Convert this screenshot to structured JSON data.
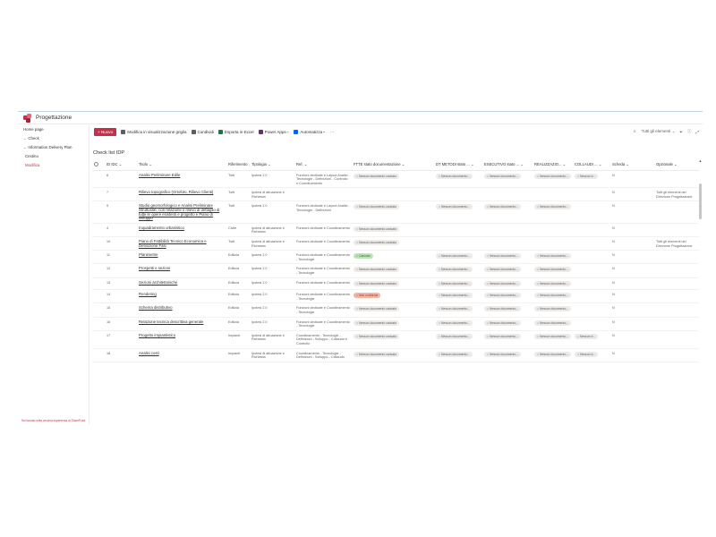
{
  "app": {
    "title": "Progettazione"
  },
  "sidebar": {
    "items": [
      {
        "label": "Home page",
        "level": 1
      },
      {
        "label": "Check",
        "level": 1,
        "expandable": true
      },
      {
        "label": "Information Delivery Plan",
        "level": 1,
        "expandable": true
      },
      {
        "label": "Cestino",
        "level": 2
      },
      {
        "label": "Modifica",
        "level": 2,
        "active": true
      }
    ],
    "footer": "Sei tornato nella vecchia esperienza di SharePoint"
  },
  "toolbar": {
    "new_label": "Nuovo",
    "commands": [
      {
        "label": "Modifica in visualizzazione griglia",
        "icon": "grid-icon",
        "color": "#605e5c"
      },
      {
        "label": "Condividi",
        "icon": "share-icon",
        "color": "#605e5c"
      },
      {
        "label": "Esporta in Excel",
        "icon": "excel-icon",
        "color": "#217346"
      },
      {
        "label": "Power Apps",
        "icon": "powerapps-icon",
        "color": "#742774"
      },
      {
        "label": "Automatizza",
        "icon": "flow-icon",
        "color": "#0066ff"
      }
    ],
    "more": "···",
    "view_label": "Tutti gli elementi"
  },
  "list": {
    "title": "Check list IDP",
    "columns": [
      "ID IDC",
      "Titolo",
      "Riferimento",
      "Tipologia",
      "Ref.",
      "FTTE stato documentazione",
      "DT METODI stato ...",
      "ESECUTIVO stato ...",
      "REALIZZAZIO...",
      "COLLAUDI ...",
      "Scheda",
      "Opzionale"
    ],
    "rows": [
      {
        "id": "8",
        "title": "Analisi Preliminare Edile",
        "rif": "Tutti",
        "tip": "Ipotesi 2.0",
        "ref": "Funzioni dedicate e Layout Analisi - Tecnologie - Definizioni - Controllo e Coordinamento",
        "ftte": "Nessun documento caricato",
        "dt": "Nessun documento...",
        "ese": "Nessun documento...",
        "real": "Nessun documento...",
        "coll": "Nessun d...",
        "scheda": "N",
        "opz": ""
      },
      {
        "id": "7",
        "title": "Rilievo topografico (Ortofoto, Rilievo Clienti)",
        "rif": "Tutti",
        "tip": "Ipotesi di attuazione e Richiesta",
        "ref": "",
        "ftte": "",
        "dt": "",
        "ese": "",
        "real": "",
        "coll": "",
        "scheda": "N",
        "opz": "Tutti gli elementi del Direzione Progettazione"
      },
      {
        "id": "9",
        "title": "Studio geomorfologico e Analisi Preliminare Strutturale, con relazione e rilievo di dettaglio di tutte le opere esistenti e progetto e Piano di sviluppo",
        "rif": "Tutti",
        "tip": "Ipotesi 2.0",
        "ref": "Funzioni dedicate e Layout Analisi - Tecnologie - Definizioni",
        "ftte": "Nessun documento caricato",
        "dt": "Nessun documento...",
        "ese": "Nessun documento...",
        "real": "Nessun documento...",
        "coll": "",
        "scheda": "N",
        "opz": ""
      },
      {
        "id": "4",
        "title": "Inquadramento urbanistico",
        "rif": "Civile",
        "tip": "Ipotesi di attuazione e Richiesta",
        "ref": "Funzioni dedicate e Coordinamento",
        "ftte": "Nessun documento caricato",
        "dt": "",
        "ese": "",
        "real": "",
        "coll": "",
        "scheda": "N",
        "opz": ""
      },
      {
        "id": "10",
        "title": "Piano di Fattibilità Tecnico Economica e Definizione Fasi",
        "rif": "Tutti",
        "tip": "Ipotesi di attuazione e Richiesta",
        "ref": "Funzioni dedicate e Coordinamento",
        "ftte": "Nessun documento caricato",
        "dt": "",
        "ese": "",
        "real": "",
        "coll": "",
        "scheda": "N",
        "opz": "Tutti gli elementi del Direzione Progettazione"
      },
      {
        "id": "11",
        "title": "Planimetrie",
        "rif": "Edilizia",
        "tip": "Ipotesi 2.0",
        "ref": "Funzioni dedicate e Coordinamento - Tecnologie",
        "ftte": "Caricato",
        "ftteStatus": "green",
        "dt": "Nessun documento...",
        "ese": "Nessun documento...",
        "real": "Nessun documento...",
        "coll": "",
        "scheda": "N",
        "opz": ""
      },
      {
        "id": "12",
        "title": "Prospetti e sezioni",
        "rif": "Edilizia",
        "tip": "Ipotesi 2.0",
        "ref": "Funzioni dedicate e Coordinamento - Tecnologie",
        "ftte": "Nessun documento caricato",
        "dt": "Nessun documento...",
        "ese": "Nessun documento...",
        "real": "Nessun documento...",
        "coll": "",
        "scheda": "N",
        "opz": ""
      },
      {
        "id": "13",
        "title": "Sezioni architettoniche",
        "rif": "Edilizia",
        "tip": "Ipotesi 2.0",
        "ref": "Funzioni dedicate e Coordinamento",
        "ftte": "Nessun documento caricato",
        "dt": "Nessun documento...",
        "ese": "Nessun documento...",
        "real": "Nessun documento...",
        "coll": "",
        "scheda": "N",
        "opz": ""
      },
      {
        "id": "14",
        "title": "Rendering",
        "rif": "Edilizia",
        "tip": "Ipotesi 2.0",
        "ref": "Funzioni dedicate e Coordinamento - Tecnologie",
        "ftte": "Non conforme",
        "ftteStatus": "red",
        "dt": "Nessun documento...",
        "ese": "Nessun documento...",
        "real": "Nessun documento...",
        "coll": "",
        "scheda": "N",
        "opz": ""
      },
      {
        "id": "15",
        "title": "Schema distributivo",
        "rif": "Edilizia",
        "tip": "Ipotesi 2.0",
        "ref": "Funzioni dedicate e Coordinamento - Tecnologie",
        "ftte": "Nessun documento caricato",
        "dt": "Nessun documento...",
        "ese": "Nessun documento...",
        "real": "Nessun documento...",
        "coll": "",
        "scheda": "N",
        "opz": ""
      },
      {
        "id": "16",
        "title": "Relazione tecnica descrittiva generale",
        "rif": "Edilizia",
        "tip": "Ipotesi 2.0",
        "ref": "Funzioni dedicate e Coordinamento - Tecnologie",
        "ftte": "Nessun documento caricato",
        "dt": "Nessun documento...",
        "ese": "Nessun documento...",
        "real": "Nessun documento...",
        "coll": "",
        "scheda": "N",
        "opz": ""
      },
      {
        "id": "17",
        "title": "Progetto impiantistico",
        "rif": "Impianti",
        "tip": "Ipotesi di attuazione e Richiesta",
        "ref": "Coordinamento - Tecnologie - Definizioni - Sviluppo - Collaudo e Controllo",
        "ftte": "Nessun documento caricato",
        "dt": "Nessun documento...",
        "ese": "Nessun documento...",
        "real": "Nessun documento...",
        "coll": "Nessun d...",
        "scheda": "N",
        "opz": ""
      },
      {
        "id": "18",
        "title": "Analisi costi",
        "rif": "Impianti",
        "tip": "Ipotesi di attuazione e Richiesta",
        "ref": "Coordinamento - Tecnologie - Definizioni - Sviluppo - Collaudo",
        "ftte": "Nessun documento caricato",
        "dt": "Nessun documento...",
        "ese": "Nessun documento...",
        "real": "Nessun documento...",
        "coll": "Nessun d...",
        "scheda": "N",
        "opz": ""
      }
    ]
  }
}
